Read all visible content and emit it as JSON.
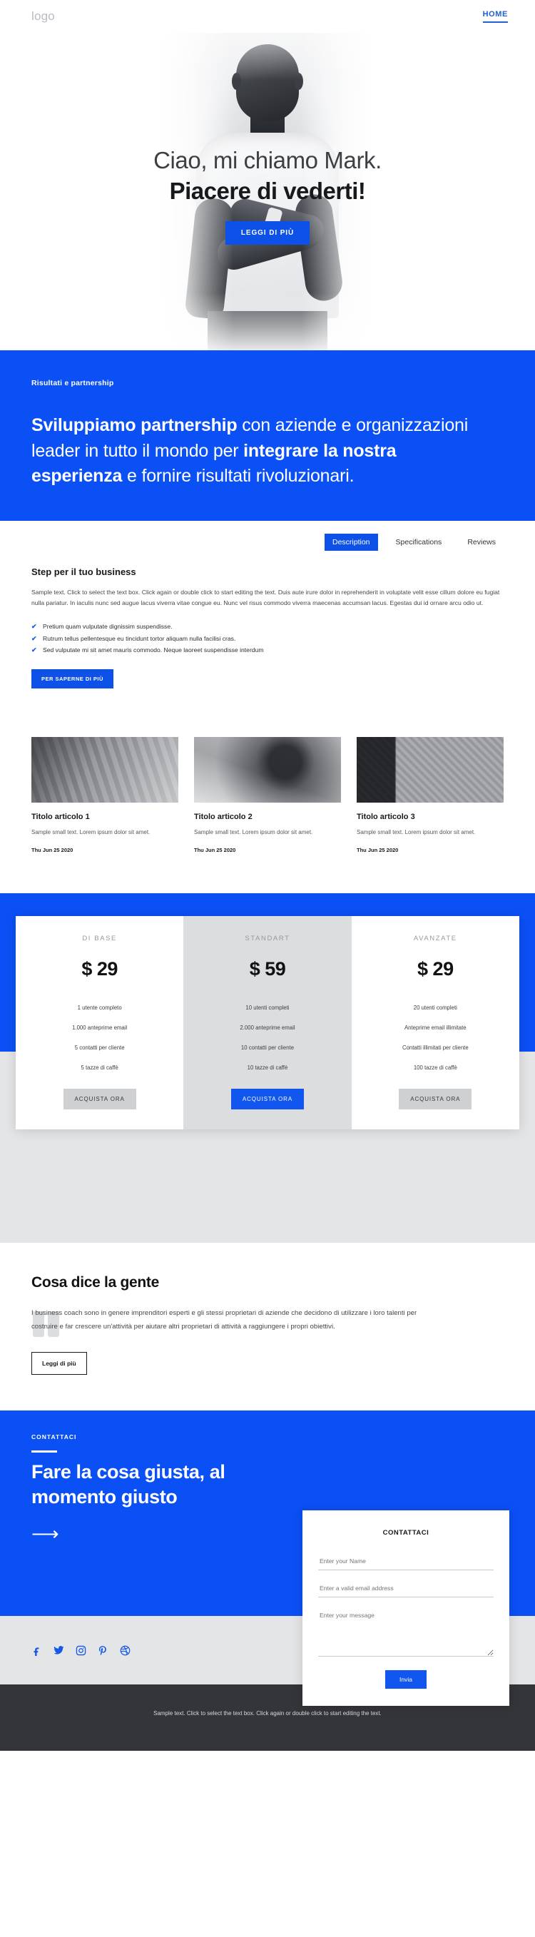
{
  "colors": {
    "primary_blue": "#0b50f5",
    "button_blue": "#0e51e8",
    "grey_bg": "#e4e5e7",
    "footer_bg": "#333538"
  },
  "header": {
    "logo": "logo",
    "nav": [
      {
        "label": "HOME",
        "active": true
      }
    ]
  },
  "hero": {
    "line1": "Ciao, mi chiamo Mark.",
    "line2": "Piacere di vederti!",
    "cta": "LEGGI DI PIÙ"
  },
  "partnership": {
    "kicker": "Risultati e partnership",
    "heading_parts": [
      {
        "text": "Sviluppiamo partnership",
        "bold": true
      },
      {
        "text": " con aziende e organizzazioni leader in tutto il mondo per ",
        "bold": false
      },
      {
        "text": "integrare la nostra esperienza",
        "bold": true
      },
      {
        "text": " e fornire risultati rivoluzionari.",
        "bold": false
      }
    ],
    "heading_b1": "Sviluppiamo partnership",
    "heading_n1": " con aziende e organizzazioni leader in tutto il mondo per ",
    "heading_b2": "integrare la nostra esperienza",
    "heading_n2": " e fornire risultati rivoluzionari."
  },
  "description": {
    "tabs": [
      {
        "label": "Description",
        "active": true
      },
      {
        "label": "Specifications",
        "active": false
      },
      {
        "label": "Reviews",
        "active": false
      }
    ],
    "title": "Step per il tuo business",
    "body": "Sample text. Click to select the text box. Click again or double click to start editing the text. Duis aute irure dolor in reprehenderit in voluptate velit esse cillum dolore eu fugiat nulla pariatur. In iaculis nunc sed augue lacus viverra vitae congue eu. Nunc vel risus commodo viverra maecenas accumsan lacus. Egestas dui id ornare arcu odio ut.",
    "checklist": [
      "Pretium quam vulputate dignissim suspendisse.",
      "Rutrum tellus pellentesque eu tincidunt tortor aliquam nulla facilisi cras.",
      "Sed vulputate mi sit amet mauris commodo. Neque laoreet suspendisse interdum"
    ],
    "cta": "PER SAPERNE DI PIÙ"
  },
  "articles": [
    {
      "title": "Titolo articolo 1",
      "text": "Sample small text. Lorem ipsum dolor sit amet.",
      "date": "Thu Jun 25 2020",
      "image": "office-laptop-photo"
    },
    {
      "title": "Titolo articolo 2",
      "text": "Sample small text. Lorem ipsum dolor sit amet.",
      "date": "Thu Jun 25 2020",
      "image": "vr-headset-photo"
    },
    {
      "title": "Titolo articolo 3",
      "text": "Sample small text. Lorem ipsum dolor sit amet.",
      "date": "Thu Jun 25 2020",
      "image": "handshake-photo"
    }
  ],
  "pricing": [
    {
      "name": "DI BASE",
      "price": "$ 29",
      "featured": false,
      "features": [
        "1 utente completo",
        "1.000 anteprime email",
        "5 contatti per cliente",
        "5 tazze di caffè"
      ],
      "cta": "ACQUISTA ORA"
    },
    {
      "name": "STANDART",
      "price": "$ 59",
      "featured": true,
      "features": [
        "10 utenti completi",
        "2.000 anteprime email",
        "10 contatti per cliente",
        "10 tazze di caffè"
      ],
      "cta": "ACQUISTA ORA"
    },
    {
      "name": "AVANZATE",
      "price": "$ 29",
      "featured": false,
      "features": [
        "20 utenti completi",
        "Anteprime email illimitate",
        "Contatti illimitati per cliente",
        "100 tazze di caffè"
      ],
      "cta": "ACQUISTA ORA"
    }
  ],
  "testimonial": {
    "title": "Cosa dice la gente",
    "quote": "I business coach sono in genere imprenditori esperti e gli stessi proprietari di aziende che decidono di utilizzare i loro talenti per costruire e far crescere un'attività per aiutare altri proprietari di attività a raggiungere i propri obiettivi.",
    "cta": "Leggi di più"
  },
  "contact": {
    "kicker": "CONTATTACI",
    "heading": "Fare la cosa giusta, al momento giusto",
    "arrow": "⟶",
    "form": {
      "title": "CONTATTACI",
      "name_placeholder": "Enter your Name",
      "name_value": "",
      "email_placeholder": "Enter a valid email address",
      "email_value": "",
      "message_placeholder": "Enter your message",
      "message_value": "",
      "submit": "Invia"
    }
  },
  "social": [
    {
      "name": "facebook-icon"
    },
    {
      "name": "twitter-icon"
    },
    {
      "name": "instagram-icon"
    },
    {
      "name": "pinterest-icon"
    },
    {
      "name": "dribbble-icon"
    }
  ],
  "footer": {
    "text": "Sample text. Click to select the text box. Click again or double click to start editing the text."
  }
}
